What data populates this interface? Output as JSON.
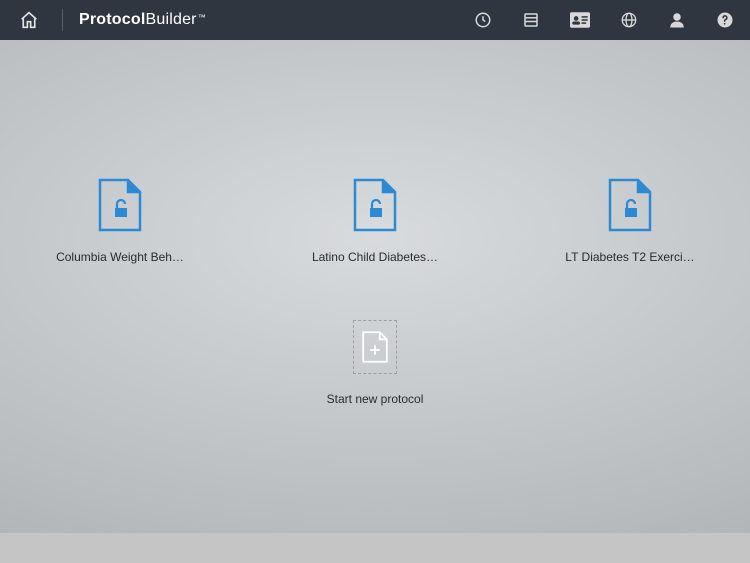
{
  "brand": {
    "bold": "Protocol",
    "light": "Builder",
    "tm": "™"
  },
  "items": [
    {
      "label": "Columbia Weight Beh…"
    },
    {
      "label": "Latino Child Diabetes…"
    },
    {
      "label": "LT Diabetes T2 Exerci…"
    }
  ],
  "newProtocol": {
    "label": "Start new protocol"
  }
}
